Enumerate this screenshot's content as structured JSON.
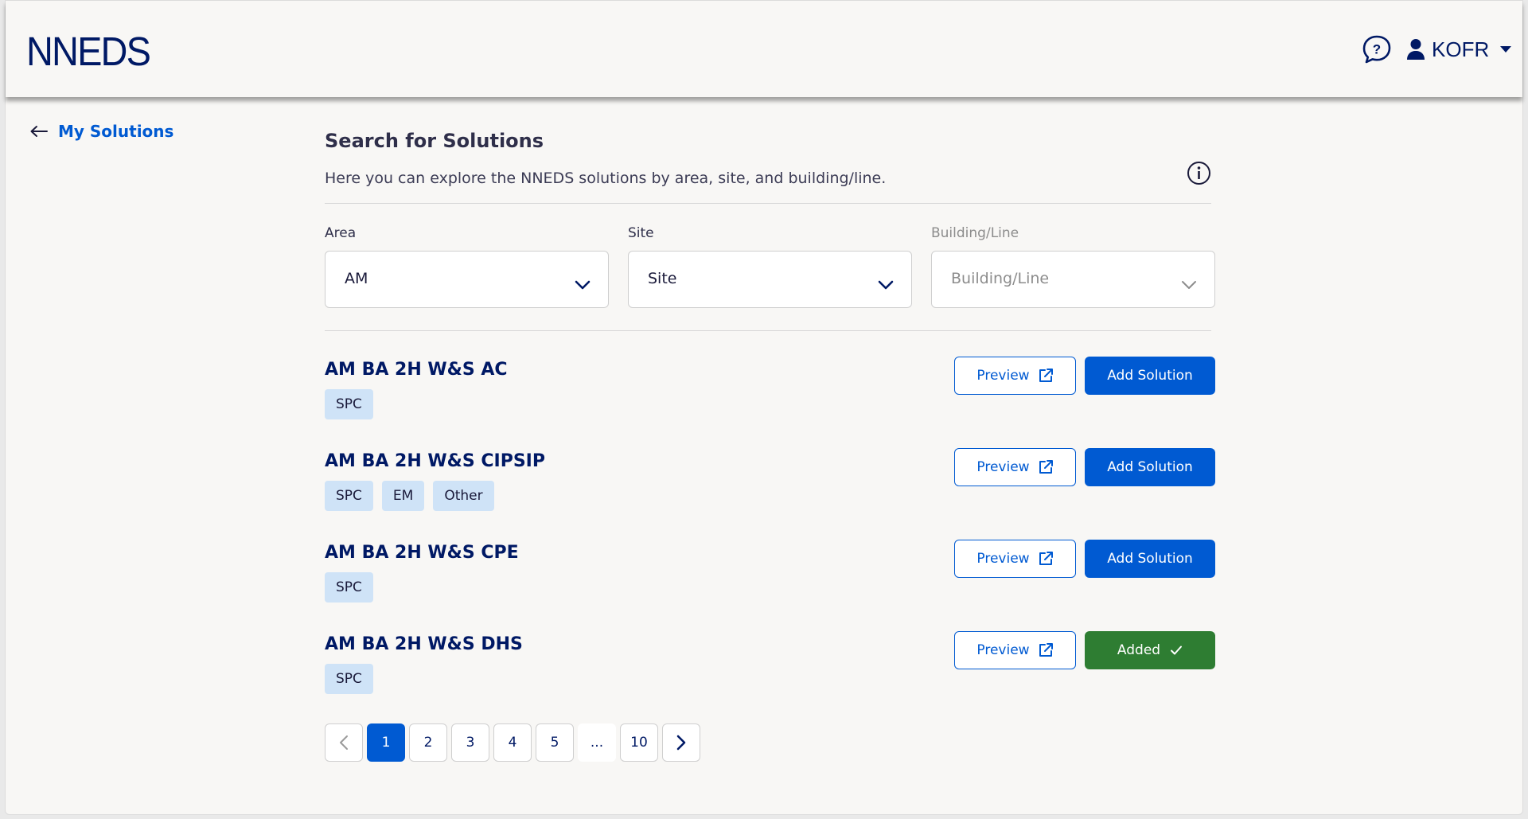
{
  "header": {
    "logo": "NNEDS",
    "user": "KOFR"
  },
  "nav": {
    "back_label": "My Solutions"
  },
  "main": {
    "title": "Search for Solutions",
    "subtitle": "Here you can explore the NNEDS solutions by area, site, and building/line."
  },
  "filters": [
    {
      "label": "Area",
      "value": "AM",
      "disabled": false
    },
    {
      "label": "Site",
      "value": "Site",
      "disabled": false
    },
    {
      "label": "Building/Line",
      "value": "Building/Line",
      "disabled": true
    }
  ],
  "solutions": [
    {
      "title": "AM BA 2H W&S AC",
      "tags": [
        "SPC"
      ],
      "preview_label": "Preview",
      "action_label": "Add Solution",
      "added": false
    },
    {
      "title": "AM BA 2H W&S CIPSIP",
      "tags": [
        "SPC",
        "EM",
        "Other"
      ],
      "preview_label": "Preview",
      "action_label": "Add Solution",
      "added": false
    },
    {
      "title": "AM BA 2H W&S CPE",
      "tags": [
        "SPC"
      ],
      "preview_label": "Preview",
      "action_label": "Add Solution",
      "added": false
    },
    {
      "title": "AM BA 2H W&S DHS",
      "tags": [
        "SPC"
      ],
      "preview_label": "Preview",
      "action_label": "Added",
      "added": true
    }
  ],
  "pagination": {
    "pages": [
      "1",
      "2",
      "3",
      "4",
      "5",
      "...",
      "10"
    ],
    "current": "1"
  },
  "colors": {
    "brand": "#001965",
    "accent": "#005ad2",
    "tag_bg": "#cfe3f7",
    "added": "#2e7d32"
  }
}
